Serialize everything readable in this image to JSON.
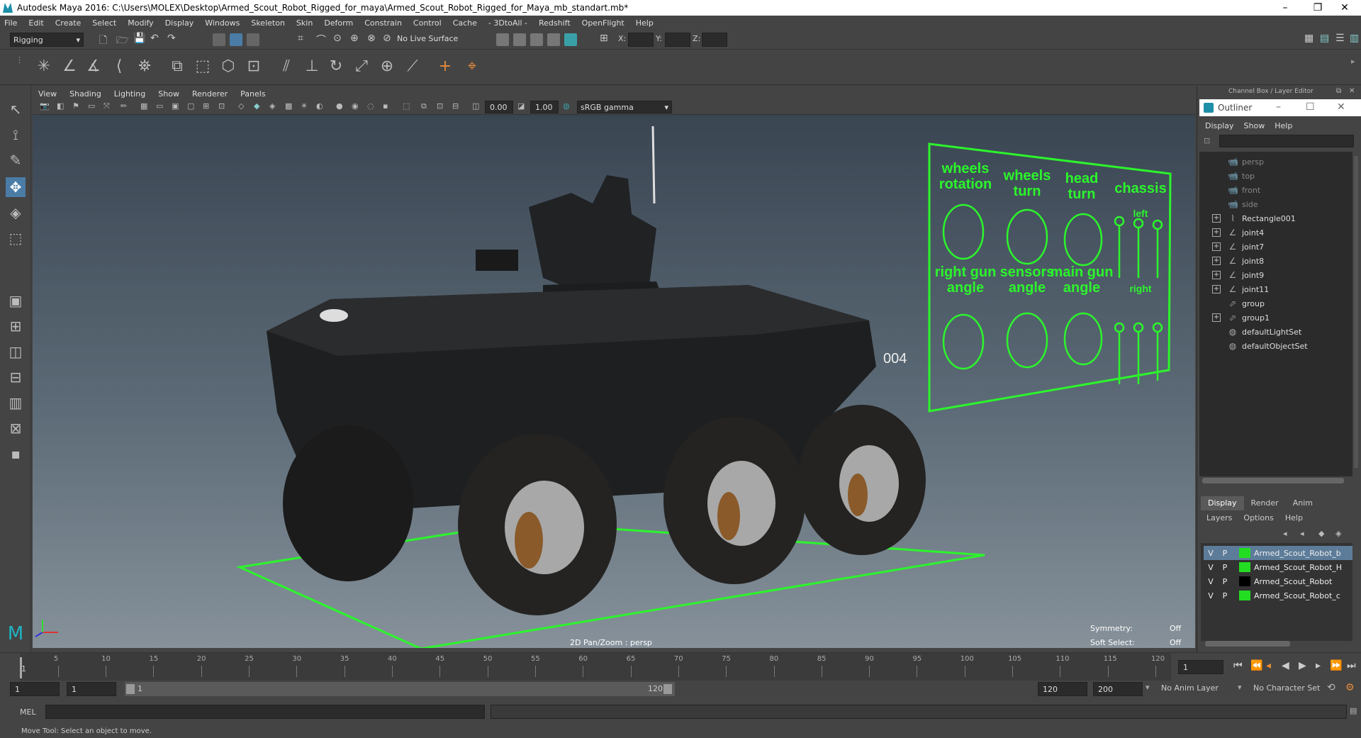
{
  "window": {
    "title": "Autodesk Maya 2016: C:\\Users\\MOLEX\\Desktop\\Armed_Scout_Robot_Rigged_for_maya\\Armed_Scout_Robot_Rigged_for_Maya_mb_standart.mb*"
  },
  "menus": [
    "File",
    "Edit",
    "Create",
    "Select",
    "Modify",
    "Display",
    "Windows",
    "Skeleton",
    "Skin",
    "Deform",
    "Constrain",
    "Control",
    "Cache",
    "- 3DtoAll -",
    "Redshift",
    "OpenFlight",
    "Help"
  ],
  "statusline": {
    "menuset": "Rigging",
    "live_surface": "No Live Surface",
    "x_label": "X:",
    "y_label": "Y:",
    "z_label": "Z:"
  },
  "viewport": {
    "menus": [
      "View",
      "Shading",
      "Lighting",
      "Show",
      "Renderer",
      "Panels"
    ],
    "exposure": "0.00",
    "gamma": "1.00",
    "color_space": "sRGB gamma",
    "camera_label": "2D Pan/Zoom : persp",
    "symmetry_label": "Symmetry:",
    "symmetry_value": "Off",
    "soft_select_label": "Soft Select:",
    "soft_select_value": "Off",
    "vehicle_number": "004",
    "rig_labels": {
      "wheels_rotation": [
        "wheels",
        "rotation"
      ],
      "wheels_turn": [
        "wheels",
        "turn"
      ],
      "head_turn": [
        "head",
        "turn"
      ],
      "chassis": "chassis",
      "left": "left",
      "right_gun_angle": [
        "right gun",
        "angle"
      ],
      "sensors_angle": [
        "sensors",
        "angle"
      ],
      "main_gun_angle": [
        "main gun",
        "angle"
      ],
      "right": "right"
    }
  },
  "channel_box": {
    "header": "Channel Box / Layer Editor"
  },
  "outliner": {
    "title": "Outliner",
    "menus": [
      "Display",
      "Show",
      "Help"
    ],
    "items": [
      {
        "label": "persp",
        "expandable": false,
        "dim": true
      },
      {
        "label": "top",
        "expandable": false,
        "dim": true
      },
      {
        "label": "front",
        "expandable": false,
        "dim": true
      },
      {
        "label": "side",
        "expandable": false,
        "dim": true
      },
      {
        "label": "Rectangle001",
        "expandable": true,
        "dim": false
      },
      {
        "label": "joint4",
        "expandable": true,
        "dim": false
      },
      {
        "label": "joint7",
        "expandable": true,
        "dim": false
      },
      {
        "label": "joint8",
        "expandable": true,
        "dim": false
      },
      {
        "label": "joint9",
        "expandable": true,
        "dim": false
      },
      {
        "label": "joint11",
        "expandable": true,
        "dim": false
      },
      {
        "label": "group",
        "expandable": false,
        "dim": false
      },
      {
        "label": "group1",
        "expandable": true,
        "dim": false
      },
      {
        "label": "defaultLightSet",
        "expandable": false,
        "dim": false
      },
      {
        "label": "defaultObjectSet",
        "expandable": false,
        "dim": false
      }
    ]
  },
  "layer_editor": {
    "tabs": [
      "Display",
      "Render",
      "Anim"
    ],
    "menus": [
      "Layers",
      "Options",
      "Help"
    ],
    "layers": [
      {
        "v": "V",
        "p": "P",
        "name": "Armed_Scout_Robot_b",
        "color": "#22dd22",
        "selected": true
      },
      {
        "v": "V",
        "p": "P",
        "name": "Armed_Scout_Robot_H",
        "color": "#22dd22",
        "selected": false
      },
      {
        "v": "V",
        "p": "P",
        "name": "Armed_Scout_Robot",
        "color": "#000000",
        "selected": false
      },
      {
        "v": "V",
        "p": "P",
        "name": "Armed_Scout_Robot_c",
        "color": "#22dd22",
        "selected": false
      }
    ]
  },
  "timeline": {
    "ticks": [
      "5",
      "10",
      "15",
      "20",
      "25",
      "30",
      "35",
      "40",
      "45",
      "50",
      "55",
      "60",
      "65",
      "70",
      "75",
      "80",
      "85",
      "90",
      "95",
      "100",
      "105",
      "110",
      "115",
      "120"
    ],
    "current_frame": "1",
    "current_time_field": "1"
  },
  "range": {
    "start": "1",
    "anim_start": "1",
    "slider_start": "1",
    "slider_end": "120",
    "anim_end": "120",
    "end": "200",
    "anim_layer": "No Anim Layer",
    "character_set": "No Character Set"
  },
  "command": {
    "label": "MEL"
  },
  "help_line": "Move Tool: Select an object to move."
}
